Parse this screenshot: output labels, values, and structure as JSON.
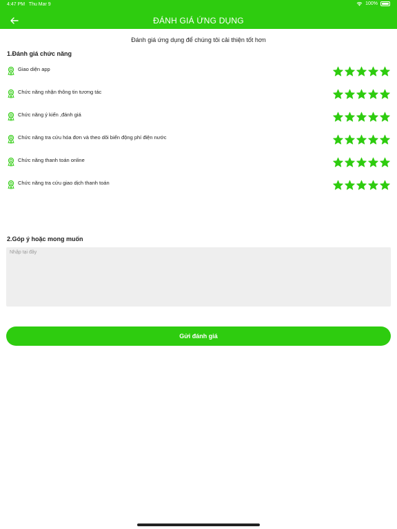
{
  "status_bar": {
    "time": "4:47 PM",
    "date": "Thu Mar 9",
    "battery": "100%"
  },
  "header": {
    "title": "ĐÁNH GIÁ ỨNG DỤNG",
    "back_icon": "arrow-left-icon"
  },
  "subtitle": "Đánh giá ứng dụng để chúng tôi cải thiện tốt hơn",
  "section1": {
    "title": "1.Đánh giá chức năng"
  },
  "features": [
    {
      "label": "Giao diện app",
      "rating": 5
    },
    {
      "label": "Chức năng nhận thông tin tương tác",
      "rating": 5
    },
    {
      "label": "Chức năng ý kiến ,đánh giá",
      "rating": 5
    },
    {
      "label": "Chức năng tra cứu hóa đơn và theo dõi biến động phí điện nước",
      "rating": 5
    },
    {
      "label": "Chức năng thanh toán online",
      "rating": 5
    },
    {
      "label": "Chức năng tra cứu giao dịch thanh toán",
      "rating": 5
    }
  ],
  "rating_max": 5,
  "section2": {
    "title": "2.Góp ý hoặc mong muốn"
  },
  "feedback": {
    "value": "",
    "placeholder": "Nhập tại đây"
  },
  "submit": {
    "label": "Gửi đánh giá"
  },
  "colors": {
    "accent": "#2ecc0f",
    "input_bg": "#eeeeee"
  }
}
